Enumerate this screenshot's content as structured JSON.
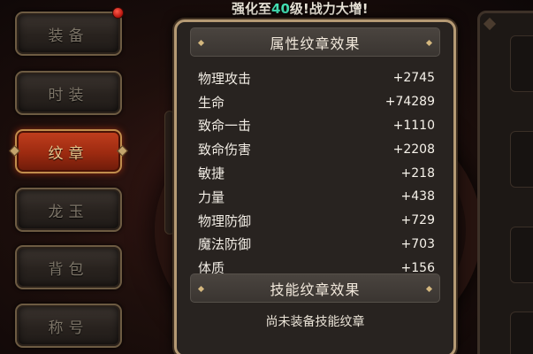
{
  "banner": {
    "prefix": "强化至",
    "level": "40",
    "suffix": "级!战力大增!"
  },
  "sidebar": {
    "items": [
      {
        "label": "装备",
        "active": false,
        "badge": true
      },
      {
        "label": "时装",
        "active": false,
        "badge": false
      },
      {
        "label": "纹章",
        "active": true,
        "badge": false
      },
      {
        "label": "龙玉",
        "active": false,
        "badge": false
      },
      {
        "label": "背包",
        "active": false,
        "badge": false
      },
      {
        "label": "称号",
        "active": false,
        "badge": false
      }
    ]
  },
  "panel": {
    "attr_title": "属性纹章效果",
    "stats": [
      {
        "name": "物理攻击",
        "value": "+2745"
      },
      {
        "name": "生命",
        "value": "+74289"
      },
      {
        "name": "致命一击",
        "value": "+1110"
      },
      {
        "name": "致命伤害",
        "value": "+2208"
      },
      {
        "name": "敏捷",
        "value": "+218"
      },
      {
        "name": "力量",
        "value": "+438"
      },
      {
        "name": "物理防御",
        "value": "+729"
      },
      {
        "name": "魔法防御",
        "value": "+703"
      },
      {
        "name": "体质",
        "value": "+156"
      }
    ],
    "skill_title": "技能纹章效果",
    "skill_empty": "尚未装备技能纹章"
  },
  "colors": {
    "highlight": "#44e0b4",
    "active_tab": "#b8361a",
    "panel_border": "#b59a74"
  }
}
